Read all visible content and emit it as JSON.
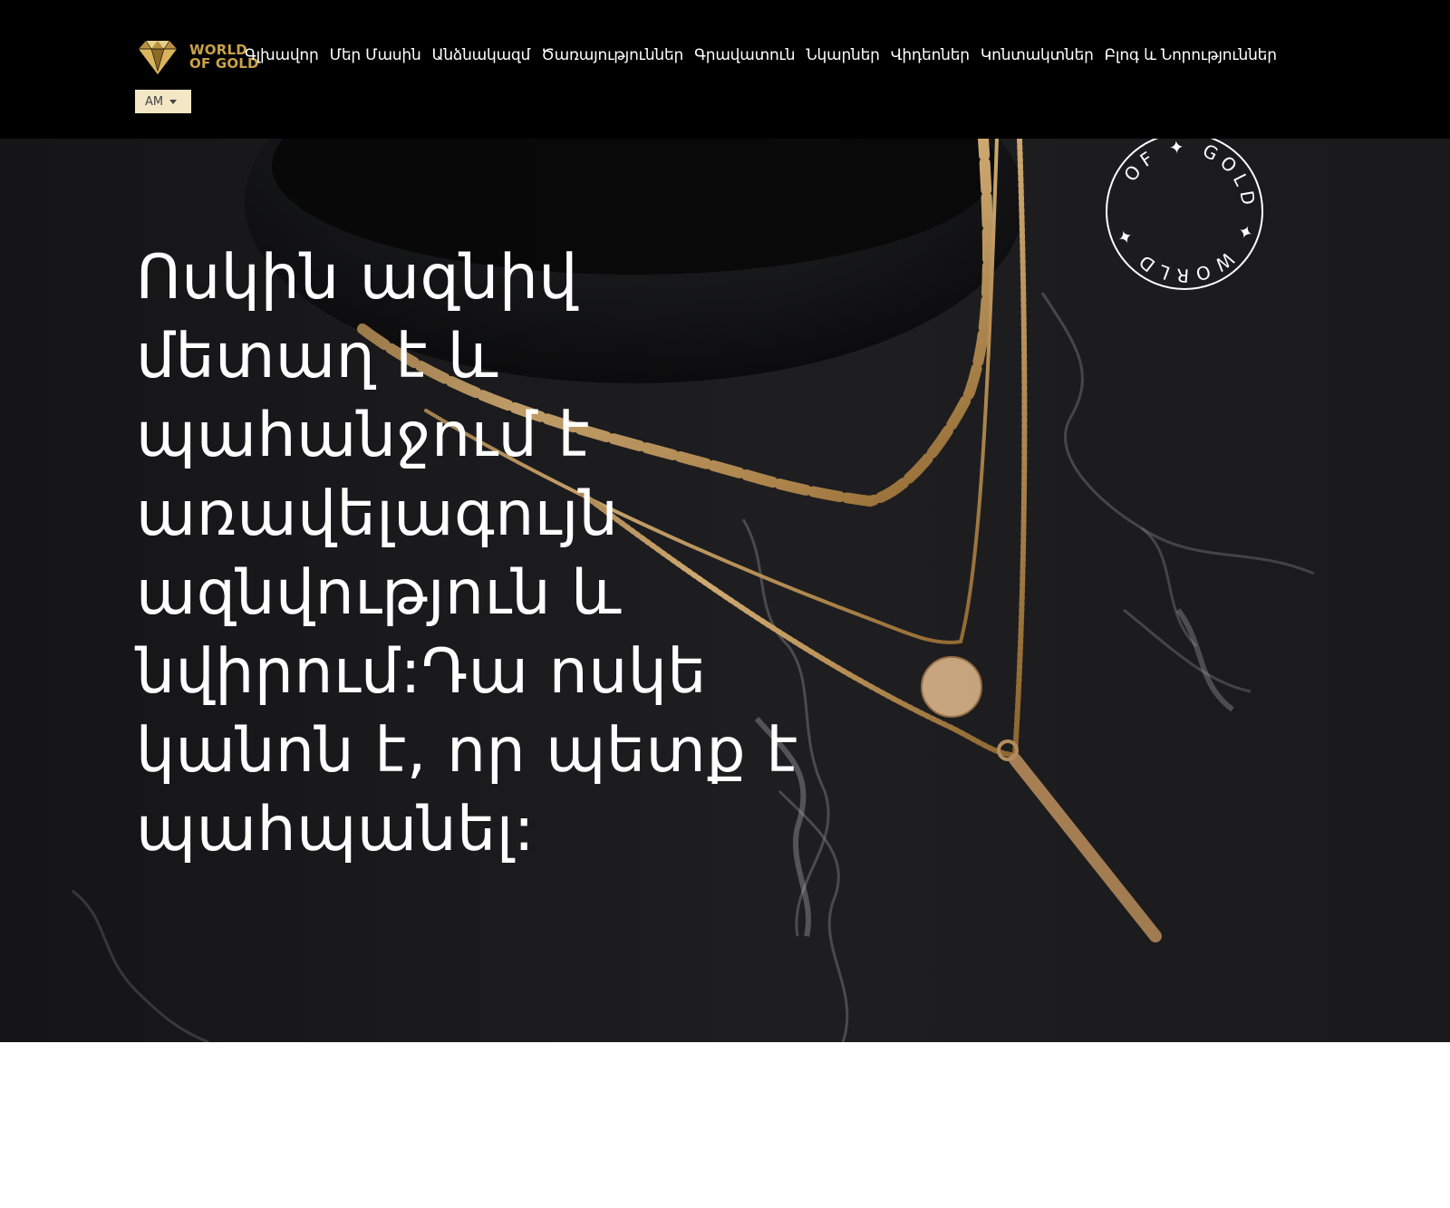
{
  "brand": {
    "line1": "WORLD",
    "line2": "OF GOLD"
  },
  "nav": {
    "items": [
      {
        "label": "Գլխավոր"
      },
      {
        "label": "Մեր Մասին"
      },
      {
        "label": "Անձնակազմ"
      },
      {
        "label": "Ծառայություններ"
      },
      {
        "label": "Գրավատուն"
      },
      {
        "label": "Նկարներ"
      },
      {
        "label": "Վիդեոներ"
      },
      {
        "label": "Կոնտակտներ"
      },
      {
        "label": "Բլոգ և Նորություններ"
      }
    ]
  },
  "language": {
    "selected": "AM"
  },
  "hero": {
    "heading": "Ոսկին ազնիվ մետաղ է և պահանջում է առավելագույն ազնվություն և նվիրում:Դա ոսկե կանոն է, որ պետք է պահպանել:",
    "seal_text": "OF ✦ GOLD ✦ WORLD ✦"
  },
  "colors": {
    "header_bg": "#000000",
    "gold": "#c9a24a",
    "lang_bg": "#f3e7c6"
  }
}
